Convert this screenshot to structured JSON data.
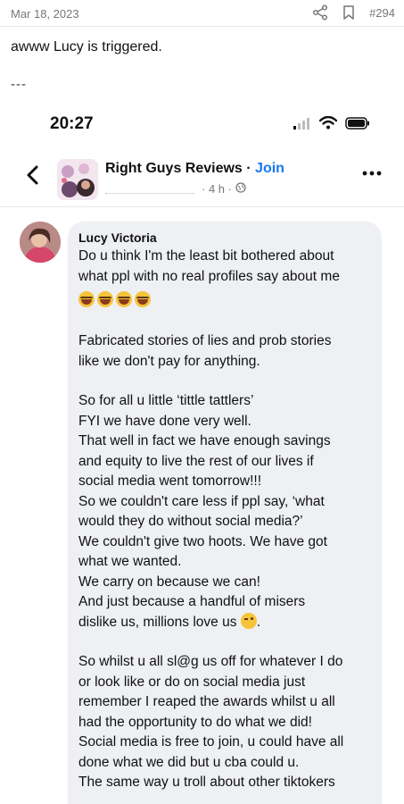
{
  "post": {
    "date": "Mar 18, 2023",
    "number": "#294",
    "text": "awww Lucy is triggered.",
    "separator": "---"
  },
  "icons": {
    "share": "share-icon",
    "bookmark": "bookmark-icon",
    "signal": "signal-icon",
    "wifi": "wifi-icon",
    "battery": "battery-icon",
    "back": "back-icon",
    "more": "more-icon",
    "globe": "globe-icon"
  },
  "phone": {
    "time": "20:27"
  },
  "group": {
    "name": "Right Guys Reviews",
    "separator": " · ",
    "join": "Join",
    "meta": "· 4 h ·"
  },
  "comment": {
    "author": "Lucy Victoria",
    "lines": [
      "Do u think I'm the least bit bothered about",
      "what ppl with no real profiles say about me",
      "",
      "Fabricated stories of lies and prob stories",
      "like we don't pay for anything.",
      "",
      "So for all u little ‘tittle tattlers’",
      "FYI we have done very well.",
      "That well in fact we have enough savings",
      "and equity to live the rest of our lives if",
      "social media went tomorrow!!!",
      "So we couldn't care less if ppl say, ‘what",
      "would they do without social media?’",
      "We couldn't give two hoots. We have got",
      "what we wanted.",
      "We carry on because we can!",
      "And just because a handful of misers",
      "dislike us, millions love us",
      "",
      "So whilst u all sl@g us off for whatever I do",
      "or look like or do on social media just",
      "remember I reaped the awards whilst u all",
      "had the opportunity to do what we did!",
      "Social media is free to join, u could have all",
      "done what we did but u cba could u.",
      "The same way u troll about other tiktokers"
    ],
    "wink_suffix": "."
  },
  "colors": {
    "link": "#1877f2",
    "bubble": "#eef0f3",
    "muted": "#777777"
  }
}
